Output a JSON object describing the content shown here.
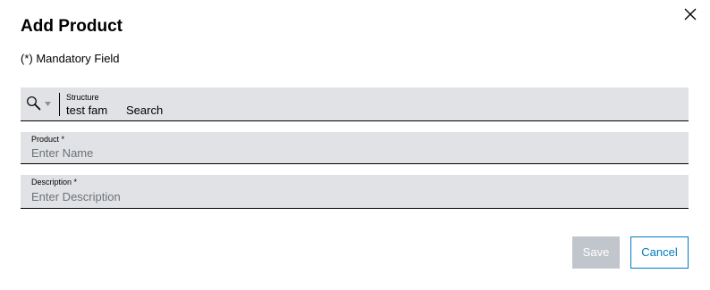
{
  "dialog": {
    "title": "Add Product",
    "mandatory_note": "(*) Mandatory Field",
    "close_icon": "close-icon"
  },
  "structure_field": {
    "label": "Structure",
    "value": "test fam",
    "search_label": "Search",
    "icons": [
      "search-icon",
      "caret-down-icon"
    ]
  },
  "product_field": {
    "label": "Product *",
    "placeholder": "Enter Name",
    "value": ""
  },
  "description_field": {
    "label": "Description *",
    "placeholder": "Enter Description",
    "value": ""
  },
  "actions": {
    "save_label": "Save",
    "save_enabled": false,
    "cancel_label": "Cancel"
  },
  "colors": {
    "field_background": "#e0e2e5",
    "accent": "#007bc0",
    "disabled_button": "#c1c6cc",
    "placeholder_text": "#6e7378"
  }
}
